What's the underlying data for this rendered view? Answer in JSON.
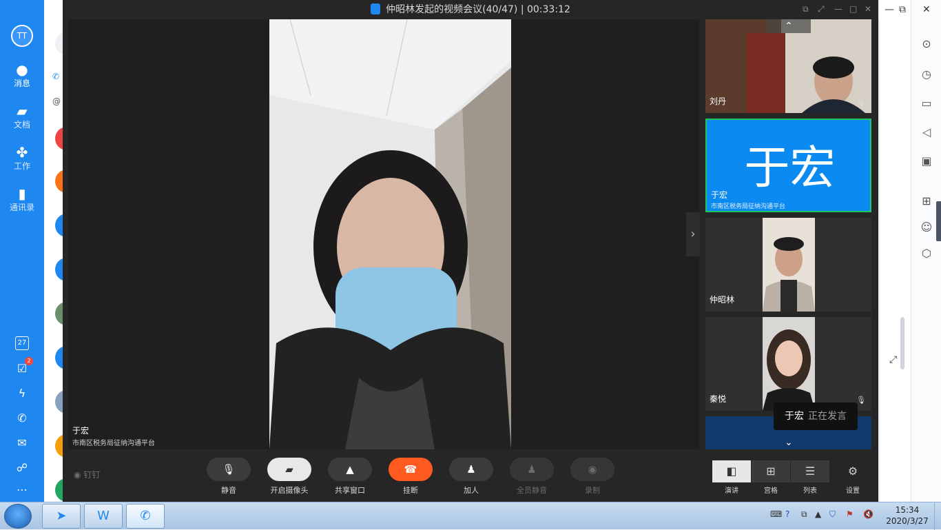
{
  "nav": {
    "avatar_text": "TT",
    "items": [
      {
        "label": "消息",
        "icon": "chat-bubble-icon"
      },
      {
        "label": "文档",
        "icon": "document-folder-icon"
      },
      {
        "label": "工作",
        "icon": "apps-grid-icon"
      },
      {
        "label": "通讯录",
        "icon": "contacts-icon"
      }
    ],
    "calendar_day": "27",
    "todo_badge": "2"
  },
  "meeting": {
    "title": "仲昭林发起的视频会议(40/47) | 00:33:12",
    "main_speaker_name": "于宏",
    "main_speaker_org": "市南区税务局征纳沟通平台",
    "brand_text": "钉钉",
    "participants": [
      {
        "name": "刘丹",
        "org": ""
      },
      {
        "name": "于宏",
        "org": "市南区税务局征纳沟通平台",
        "big_text": "于宏"
      },
      {
        "name": "仲昭林",
        "org": ""
      },
      {
        "name": "秦悦",
        "org": ""
      }
    ],
    "toast_name": "于宏",
    "toast_status": "正在发言",
    "controls": [
      {
        "label": "静音",
        "icon": "microphone-icon"
      },
      {
        "label": "开启摄像头",
        "icon": "camera-off-icon"
      },
      {
        "label": "共享窗口",
        "icon": "share-screen-icon"
      },
      {
        "label": "挂断",
        "icon": "hangup-icon"
      },
      {
        "label": "加人",
        "icon": "add-person-icon"
      },
      {
        "label": "全员静音",
        "icon": "mute-all-icon"
      },
      {
        "label": "录制",
        "icon": "record-icon"
      }
    ],
    "layouts": [
      {
        "label": "演讲",
        "icon": "speaker-layout-icon"
      },
      {
        "label": "宫格",
        "icon": "grid-layout-icon"
      },
      {
        "label": "列表",
        "icon": "list-layout-icon"
      }
    ],
    "settings_label": "设置"
  },
  "taskbar": {
    "time": "15:34",
    "date": "2020/3/27"
  }
}
